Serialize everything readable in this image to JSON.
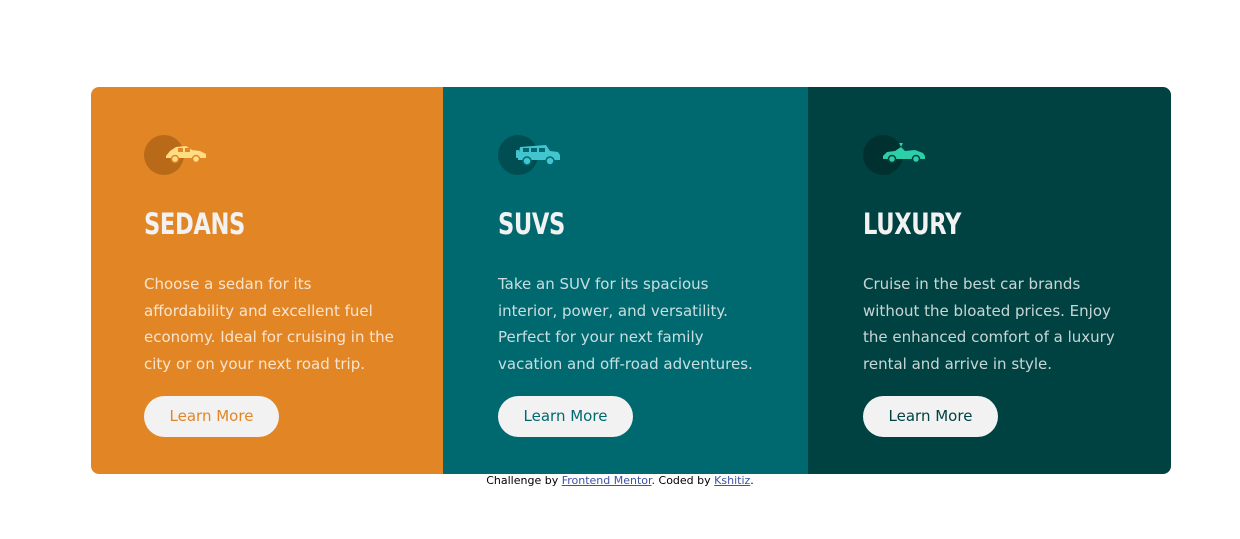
{
  "colors": {
    "sedans": "#e28625",
    "suvs": "#006970",
    "luxury": "#004241",
    "button_bg": "#f2f2f2",
    "link": "#3e52a3"
  },
  "cards": [
    {
      "icon": "sedan-car-icon",
      "title": "SEDANS",
      "text": "Choose a sedan for its affordability and excellent fuel economy. Ideal for cruising in the city or on your next road trip.",
      "button": "Learn More"
    },
    {
      "icon": "suv-car-icon",
      "title": "SUVS",
      "text": "Take an SUV for its spacious interior, power, and versatility. Perfect for your next family vacation and off-road adventures.",
      "button": "Learn More"
    },
    {
      "icon": "luxury-car-icon",
      "title": "LUXURY",
      "text": "Cruise in the best car brands without the bloated prices. Enjoy the enhanced comfort of a luxury rental and arrive in style.",
      "button": "Learn More"
    }
  ],
  "attribution": {
    "prefix": "Challenge by ",
    "challenge_link": "Frontend Mentor",
    "middle": ". Coded by ",
    "author_link": "Kshitiz",
    "suffix": "."
  }
}
